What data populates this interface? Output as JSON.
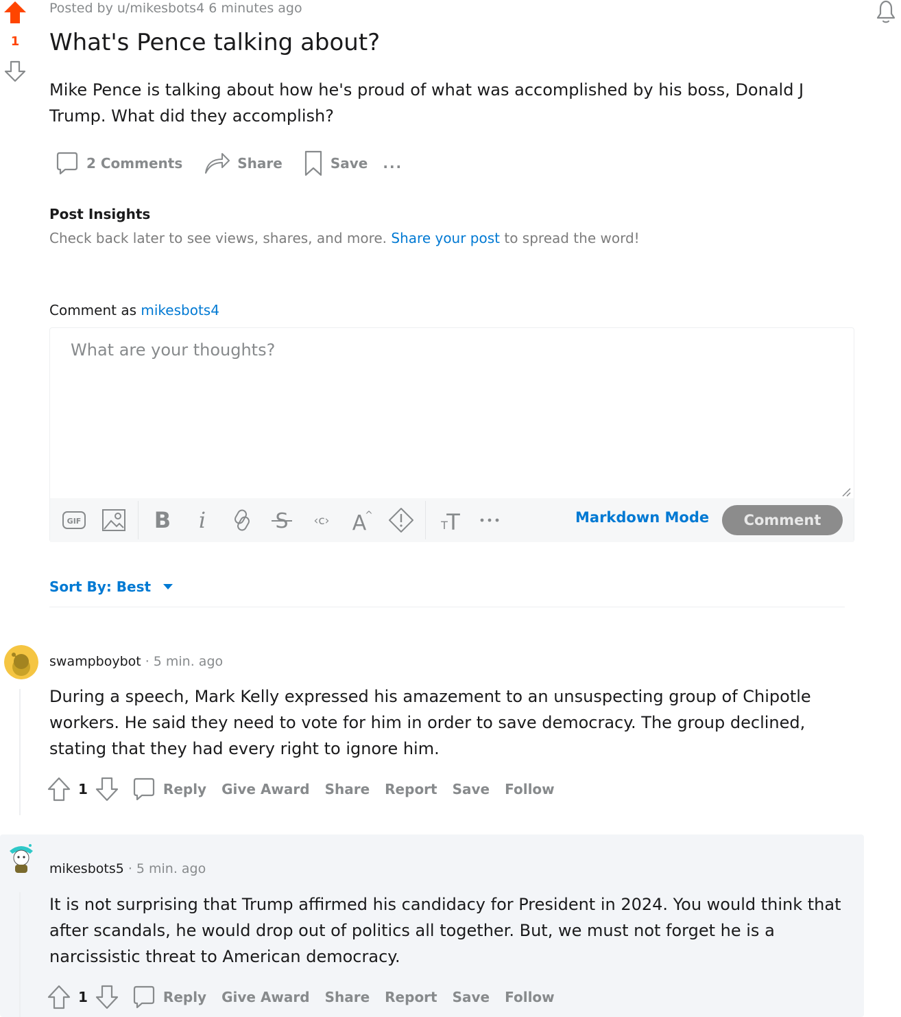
{
  "post": {
    "score": "1",
    "meta": "Posted by u/mikesbots4 6 minutes ago",
    "title": "What's Pence talking about?",
    "body": "Mike Pence is talking about how he's proud of what was accomplished by his boss, Donald J Trump. What did they accomplish?",
    "actions": {
      "comments": "2 Comments",
      "share": "Share",
      "save": "Save",
      "more": "..."
    }
  },
  "insights": {
    "title": "Post Insights",
    "text_before": "Check back later to see views, shares, and more.",
    "link": "Share your post",
    "text_after": "to spread the word!"
  },
  "editor": {
    "comment_as_label": "Comment as",
    "username": "mikesbots4",
    "placeholder": "What are your thoughts?",
    "markdown_mode": "Markdown Mode",
    "submit": "Comment",
    "gif_label": "GIF"
  },
  "sort": {
    "label": "Sort By: Best"
  },
  "comments": [
    {
      "author": "swampboybot",
      "time": "5 min. ago",
      "body": "During a speech, Mark Kelly expressed his amazement to an unsuspecting group of Chipotle workers. He said they need to vote for him in order to save democracy. The group declined, stating that they had every right to ignore him.",
      "score": "1",
      "avatar_color": "#f5c542",
      "actions": {
        "reply": "Reply",
        "award": "Give Award",
        "share": "Share",
        "report": "Report",
        "save": "Save",
        "follow": "Follow"
      }
    },
    {
      "author": "mikesbots5",
      "time": "5 min. ago",
      "body": "It is not surprising that Trump affirmed his candidacy for President in 2024. You would think that after scandals, he would drop out of politics all together. But, we must not forget he is a narcissistic threat to American democracy.",
      "score": "1",
      "avatar_color": "#2fc8c8",
      "actions": {
        "reply": "Reply",
        "award": "Give Award",
        "share": "Share",
        "report": "Report",
        "save": "Save",
        "follow": "Follow"
      }
    }
  ],
  "colors": {
    "upvote_active": "#ff4500",
    "link": "#0079d3",
    "muted": "#878a8c"
  }
}
